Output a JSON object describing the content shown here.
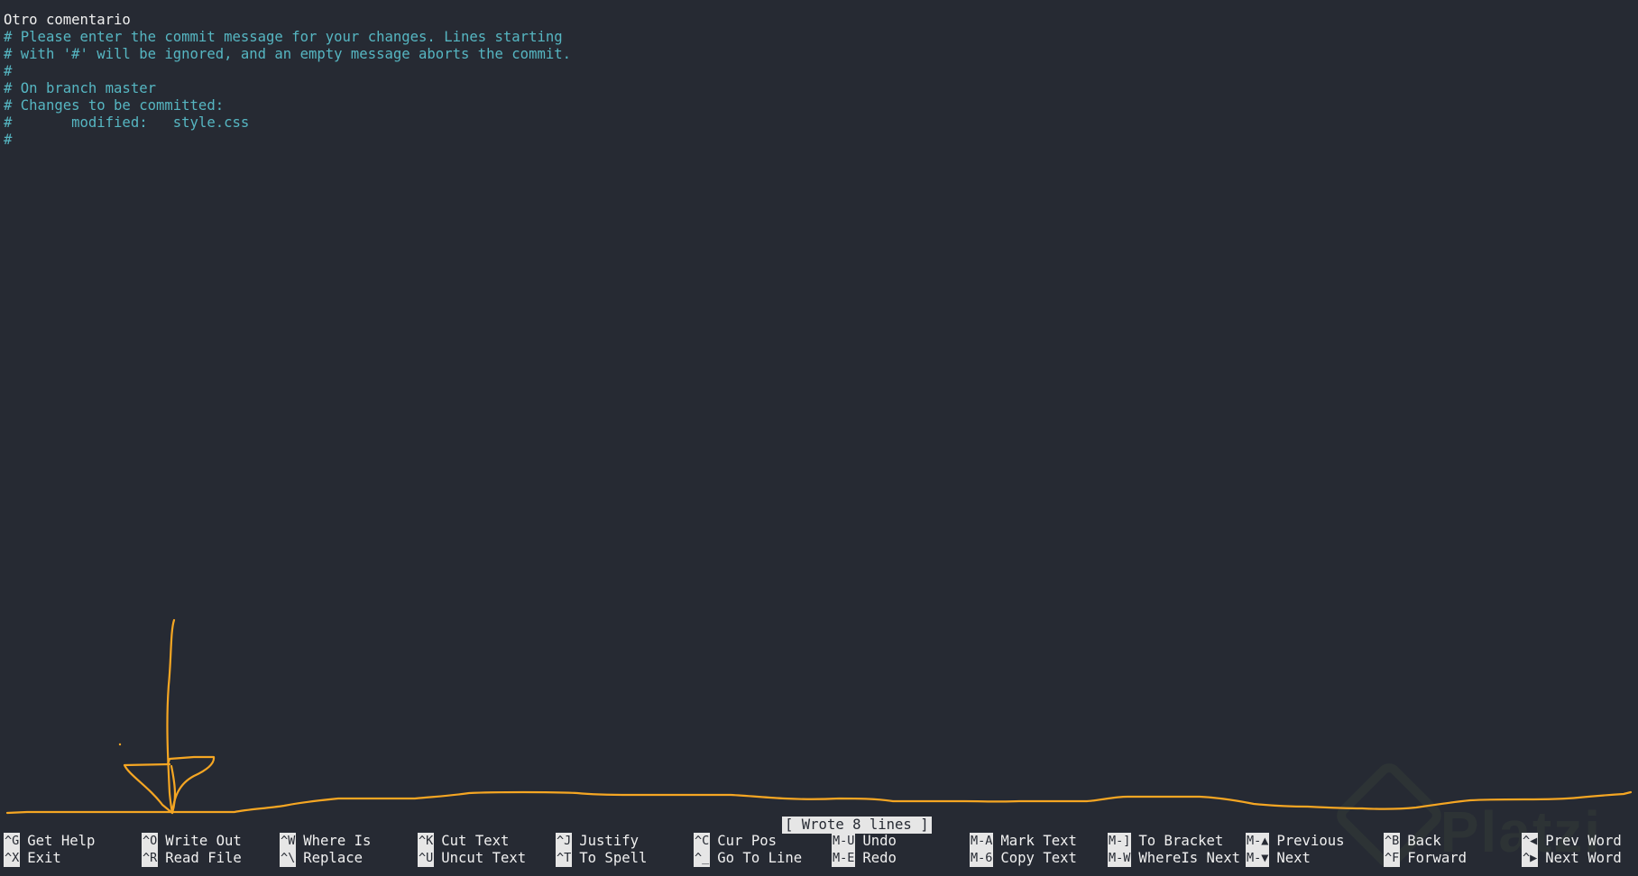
{
  "editor": {
    "lines": [
      {
        "text": "Otro comentario",
        "type": "msg"
      },
      {
        "text": "# Please enter the commit message for your changes. Lines starting",
        "type": "comment"
      },
      {
        "text": "# with '#' will be ignored, and an empty message aborts the commit.",
        "type": "comment"
      },
      {
        "text": "#",
        "type": "comment"
      },
      {
        "text": "# On branch master",
        "type": "comment"
      },
      {
        "text": "# Changes to be committed:",
        "type": "comment"
      },
      {
        "text": "#       modified:   style.css",
        "type": "comment"
      },
      {
        "text": "#",
        "type": "comment"
      }
    ]
  },
  "status": "[ Wrote 8 lines ]",
  "shortcuts": {
    "row1": [
      {
        "key": "^G",
        "label": "Get Help"
      },
      {
        "key": "^O",
        "label": "Write Out"
      },
      {
        "key": "^W",
        "label": "Where Is"
      },
      {
        "key": "^K",
        "label": "Cut Text"
      },
      {
        "key": "^J",
        "label": "Justify"
      },
      {
        "key": "^C",
        "label": "Cur Pos"
      },
      {
        "key": "M-U",
        "label": "Undo"
      },
      {
        "key": "M-A",
        "label": "Mark Text"
      },
      {
        "key": "M-]",
        "label": "To Bracket"
      },
      {
        "key": "M-▲",
        "label": "Previous"
      },
      {
        "key": "^B",
        "label": "Back"
      },
      {
        "key": "^◀",
        "label": "Prev Word"
      }
    ],
    "row2": [
      {
        "key": "^X",
        "label": "Exit"
      },
      {
        "key": "^R",
        "label": "Read File"
      },
      {
        "key": "^\\",
        "label": "Replace"
      },
      {
        "key": "^U",
        "label": "Uncut Text"
      },
      {
        "key": "^T",
        "label": "To Spell"
      },
      {
        "key": "^_",
        "label": "Go To Line"
      },
      {
        "key": "M-E",
        "label": "Redo"
      },
      {
        "key": "M-6",
        "label": "Copy Text"
      },
      {
        "key": "M-W",
        "label": "WhereIs Next"
      },
      {
        "key": "M-▼",
        "label": "Next"
      },
      {
        "key": "^F",
        "label": "Forward"
      },
      {
        "key": "^▶",
        "label": "Next Word"
      }
    ]
  },
  "colors": {
    "background": "#262a33",
    "comment": "#56b6c2",
    "text": "#f0f0f0",
    "annotation": "#f5a623"
  },
  "watermark": "Platzi"
}
